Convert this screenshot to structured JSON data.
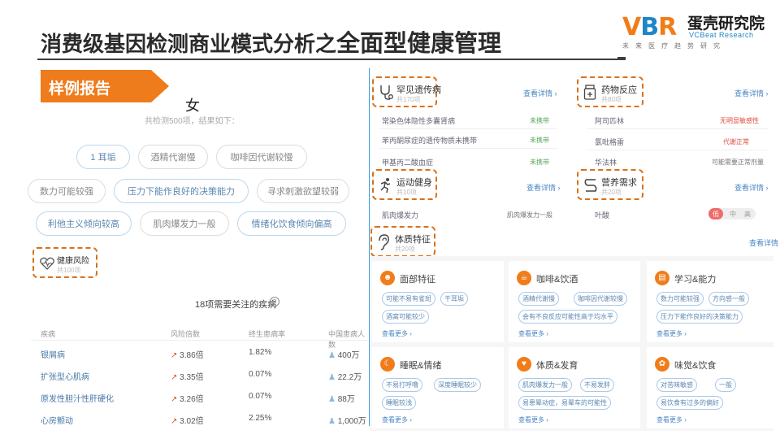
{
  "slide": {
    "title_part1": "消费级基因检测商业模式分析之",
    "title_part2": "全面型健康管理",
    "badge": "样例报告"
  },
  "brand": {
    "logo_v": "V",
    "logo_b": "B",
    "logo_r": "R",
    "name_cn": "蛋壳研究院",
    "name_en": "VCBeat Research",
    "tagline": "未来医疗趋势研究"
  },
  "colors": {
    "accent_orange": "#ef7c1c",
    "link_blue": "#4a86c5",
    "divider_blue": "#3e9ae0",
    "dashed_orange": "#d9701a"
  },
  "traits": {
    "gender": "女",
    "summary": "共检测500项，结果如下：",
    "pills": [
      "1 耳垢",
      "酒精代谢慢",
      "咖啡因代谢较慢",
      "数力可能较强",
      "压力下能作良好的决策能力",
      "寻求刺激欲望较弱",
      "利他主义倾向较高",
      "肌肉爆发力一般",
      "情绪化饮食倾向偏高"
    ]
  },
  "health_risk": {
    "title": "健康风险",
    "count": "共100项"
  },
  "disease_table": {
    "heading": "18项需要关注的疾病",
    "columns": [
      "疾病",
      "风险倍数",
      "终生患病率",
      "中国患病人数"
    ],
    "rows": [
      {
        "name": "银屑病",
        "risk": "3.86倍",
        "rate": "1.82%",
        "people": "400万"
      },
      {
        "name": "扩张型心肌病",
        "risk": "3.35倍",
        "rate": "0.07%",
        "people": "22.2万"
      },
      {
        "name": "原发性胆汁性肝硬化",
        "risk": "3.26倍",
        "rate": "0.07%",
        "people": "88万"
      },
      {
        "name": "心房颤动",
        "risk": "3.02倍",
        "rate": "2.25%",
        "people": "1,000万"
      }
    ]
  },
  "right": {
    "hereditary": {
      "title": "罕见遗传病",
      "count": "共170项",
      "link": "查看详情 ›",
      "rows": [
        {
          "name": "常染色体隐性多囊肾病",
          "value": "未携带"
        },
        {
          "name": "苯丙酮尿症的遗传物质未携带",
          "value": "未携带"
        },
        {
          "name": "甲基丙二酸血症",
          "value": "未携带"
        }
      ]
    },
    "drug": {
      "title": "药物反应",
      "count": "共80项",
      "link": "查看详情 ›",
      "rows": [
        {
          "name": "阿司匹林",
          "value": "无明显敏感性"
        },
        {
          "name": "氯吡格雷",
          "value": "代谢正常"
        },
        {
          "name": "华法林",
          "value": "可能需要正常剂量"
        }
      ]
    },
    "sports": {
      "title": "运动健身",
      "count": "共10项",
      "link": "查看详情 ›",
      "rows": [
        {
          "name": "肌肉爆发力",
          "value": "肌肉爆发力一般"
        }
      ]
    },
    "nutrition": {
      "title": "营养需求",
      "count": "共20项",
      "link": "查看详情 ›",
      "rows": [
        {
          "name": "叶酸",
          "value": ""
        }
      ],
      "toggle": [
        "低",
        "中",
        "高"
      ]
    },
    "traits_card": {
      "title": "体质特征",
      "count": "共20项",
      "link": "查看详情 ›"
    },
    "cards": [
      {
        "icon": "head-icon",
        "icon_char": "☻",
        "title": "面部特征",
        "tags": [
          "可能不易有雀斑",
          "干耳垢",
          "酒窝可能较少"
        ],
        "more": "查看更多 ›"
      },
      {
        "icon": "coffee-icon",
        "icon_char": "☕",
        "title": "咖啡&饮酒",
        "tags": [
          "酒精代谢慢",
          "咖啡因代谢较慢",
          "会有不良反应可能性高于均水平"
        ],
        "more": "查看更多 ›"
      },
      {
        "icon": "book-icon",
        "icon_char": "▤",
        "title": "学习&能力",
        "tags": [
          "数力可能较强",
          "方向感一般",
          "压力下能作良好的决策能力"
        ],
        "more": "查看更多 ›"
      },
      {
        "icon": "sleep-icon",
        "icon_char": "☾",
        "title": "睡眠&情绪",
        "tags": [
          "不易打呼噜",
          "深度睡眠较少",
          "睡眠较浅"
        ],
        "more": "查看更多 ›"
      },
      {
        "icon": "body-icon",
        "icon_char": "♥",
        "title": "体质&发育",
        "tags": [
          "肌肉爆发力一般",
          "不易发胖",
          "易患晕动症，易晕车的可能性"
        ],
        "more": "查看更多 ›"
      },
      {
        "icon": "taste-icon",
        "icon_char": "✿",
        "title": "味觉&饮食",
        "tags": [
          "对苦味敏感",
          "一般",
          "易饮食有过多的偏好"
        ],
        "more": "查看更多 ›"
      }
    ]
  }
}
